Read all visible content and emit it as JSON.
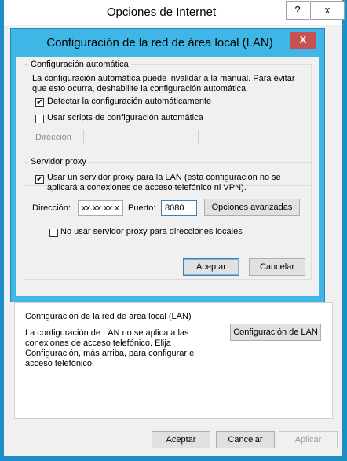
{
  "outer": {
    "title": "Opciones de Internet",
    "help_label": "?",
    "close_label": "x",
    "lan_section_title": "Configuración de la red de área local (LAN)",
    "lan_section_desc_1": "La configuración de LAN no se aplica a las",
    "lan_section_desc_2": "conexiones de acceso telefónico. Elija",
    "lan_section_desc_3": "Configuración, más arriba, para configurar el",
    "lan_section_desc_4": "acceso telefónico.",
    "lan_settings_button": "Configuración de LAN",
    "ok_button": "Aceptar",
    "cancel_button": "Cancelar",
    "apply_button": "Aplicar"
  },
  "lan_dialog": {
    "title": "Configuración de la red de área local (LAN)",
    "close_label": "X",
    "auto": {
      "legend": "Configuración automática",
      "desc_1": "La configuración automática puede invalidar a la manual. Para evitar",
      "desc_2": "que esto ocurra, deshabilite la configuración automática.",
      "detect_label": "Detectar la configuración automáticamente",
      "detect_checked": true,
      "script_label": "Usar scripts de configuración automática",
      "script_checked": false,
      "address_label": "Dirección",
      "address_value": ""
    },
    "proxy": {
      "legend": "Servidor proxy",
      "use_proxy_label_1": "Usar un servidor proxy para la LAN (esta configuración no se",
      "use_proxy_label_2": "aplicará a conexiones de acceso telefónico ni VPN).",
      "use_proxy_checked": true,
      "address_label": "Dirección:",
      "address_value": "xx.xx.xx.x",
      "port_label": "Puerto:",
      "port_value": "8080",
      "advanced_button": "Opciones avanzadas",
      "bypass_label": "No usar servidor proxy para direcciones locales",
      "bypass_checked": false
    },
    "ok_button": "Aceptar",
    "cancel_button": "Cancelar"
  },
  "colors": {
    "accent": "#3fb7e6",
    "close_red": "#c75050",
    "outer_border": "#1e8ec9"
  }
}
